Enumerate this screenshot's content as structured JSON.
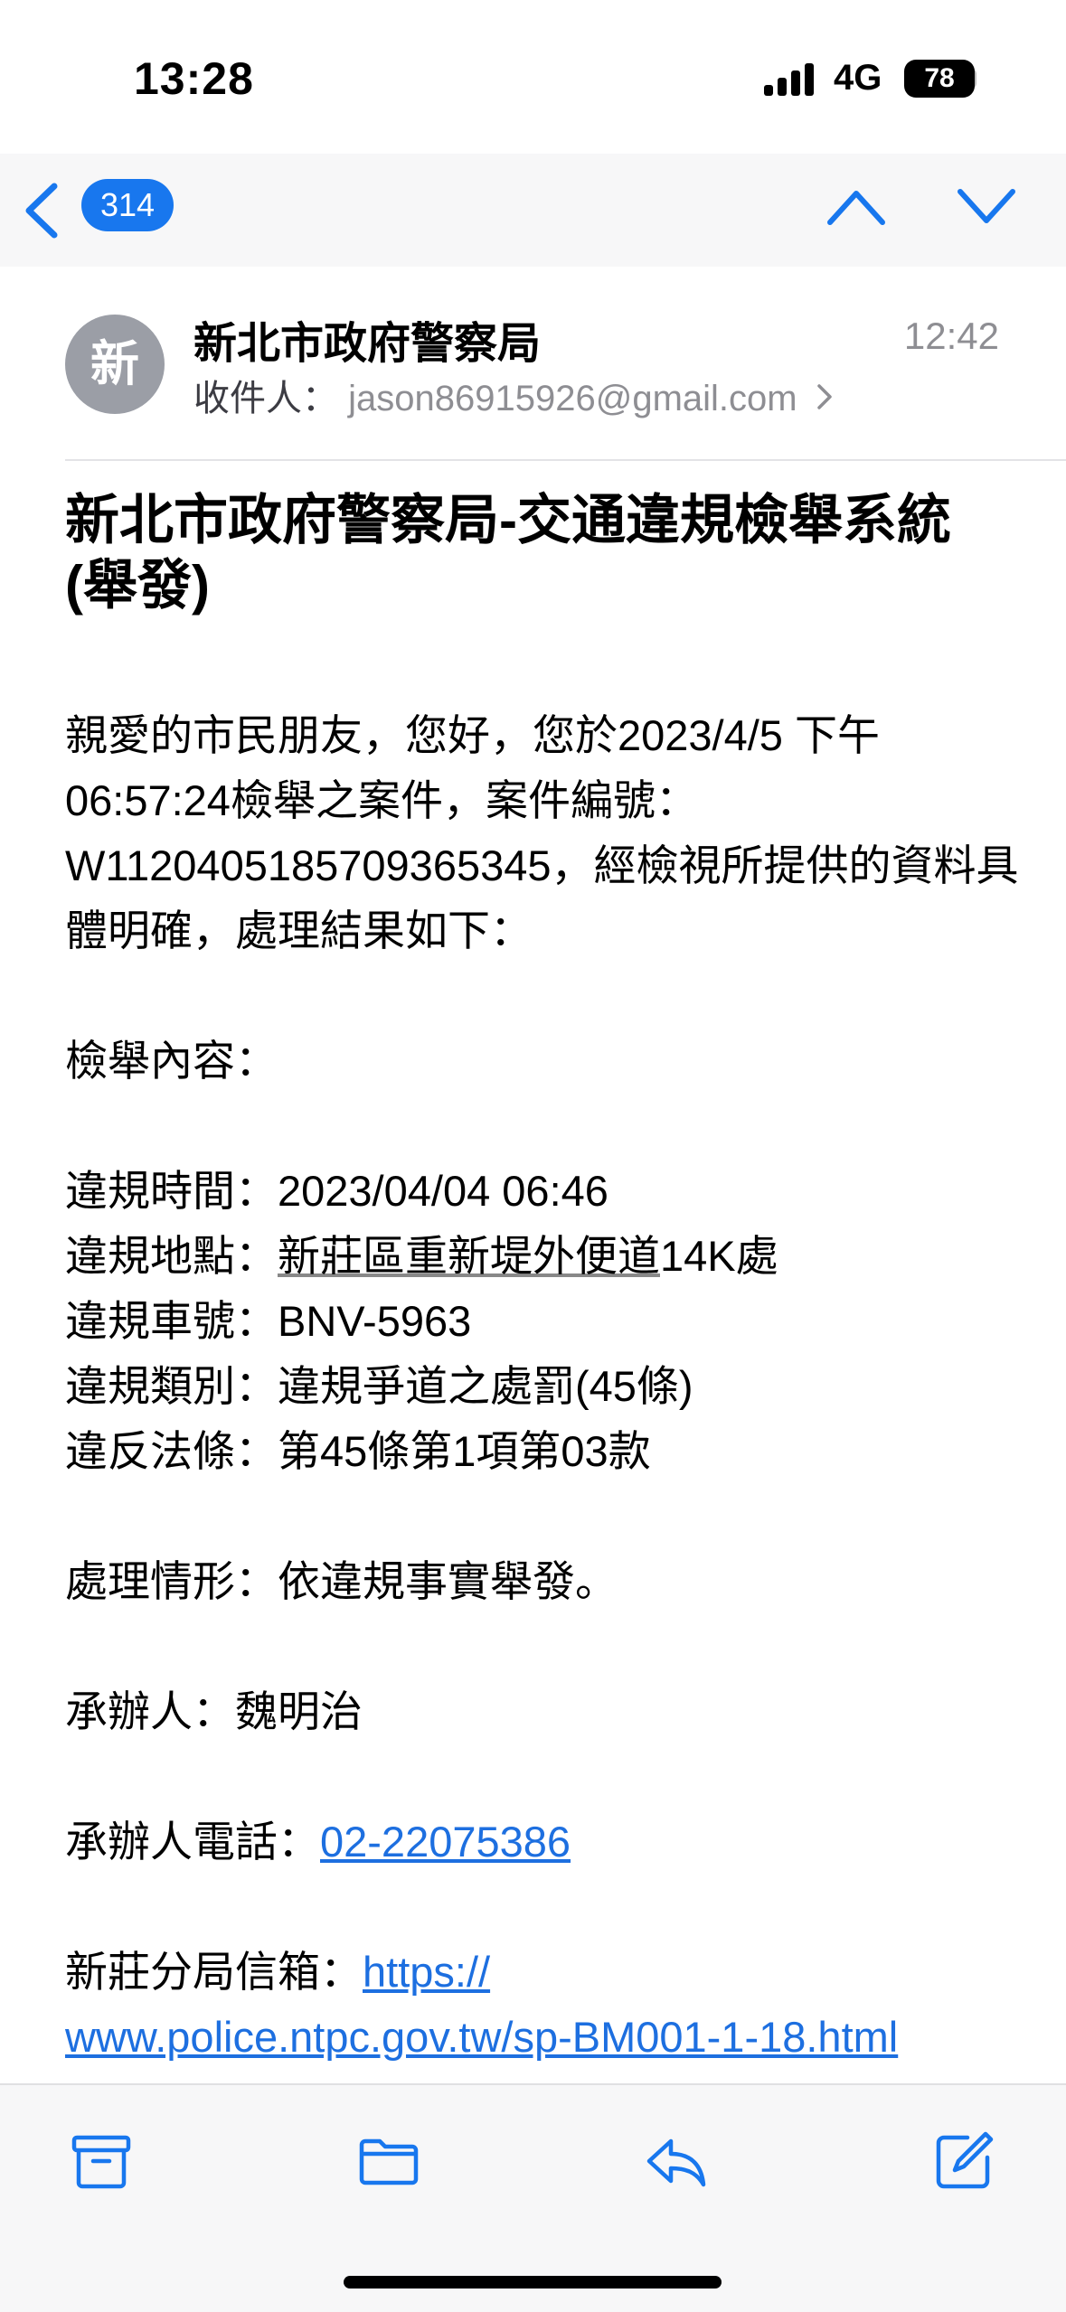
{
  "status_bar": {
    "time": "13:28",
    "network": "4G",
    "battery": "78"
  },
  "nav": {
    "back_count": "314"
  },
  "email": {
    "avatar_letter": "新",
    "sender": "新北市政府警察局",
    "time": "12:42",
    "recipient_label": "收件人：",
    "recipient": "jason86915926@gmail.com",
    "subject": "新北市政府警察局-交通違規檢舉系統 (舉發)",
    "greeting": "親愛的市民朋友，您好，您於2023/4/5 下午06:57:24檢舉之案件，案件編號：W1120405185709365345，經檢視所提供的資料具體明確，處理結果如下：",
    "content_label": "檢舉內容：",
    "details": [
      {
        "label": "違規時間：",
        "value": "2023/04/04 06:46"
      },
      {
        "label": "違規地點：",
        "value": "新莊區重新堤外便道",
        "suffix": "14K處"
      },
      {
        "label": "違規車號：",
        "value": "BNV-5963"
      },
      {
        "label": "違規類別：",
        "value": "違規爭道之處罰(45條)"
      },
      {
        "label": "違反法條：",
        "value": "第45條第1項第03款"
      }
    ],
    "handling": "處理情形：依違規事實舉發。",
    "officer": "承辦人：魏明治",
    "phone_label": "承辦人電話：",
    "phone": "02-22075386",
    "mailbox_label": "新莊分局信箱：",
    "mailbox_url_part1": "https://",
    "mailbox_url_part2": "www.police.ntpc.gov.tw/sp-BM001-1-18.html"
  },
  "colors": {
    "accent": "#1877EE",
    "link": "#1D6FE0",
    "secondary": "#8E8E93"
  },
  "toolbar": {
    "icons": [
      "archive-icon",
      "folder-icon",
      "reply-icon",
      "compose-icon"
    ]
  }
}
